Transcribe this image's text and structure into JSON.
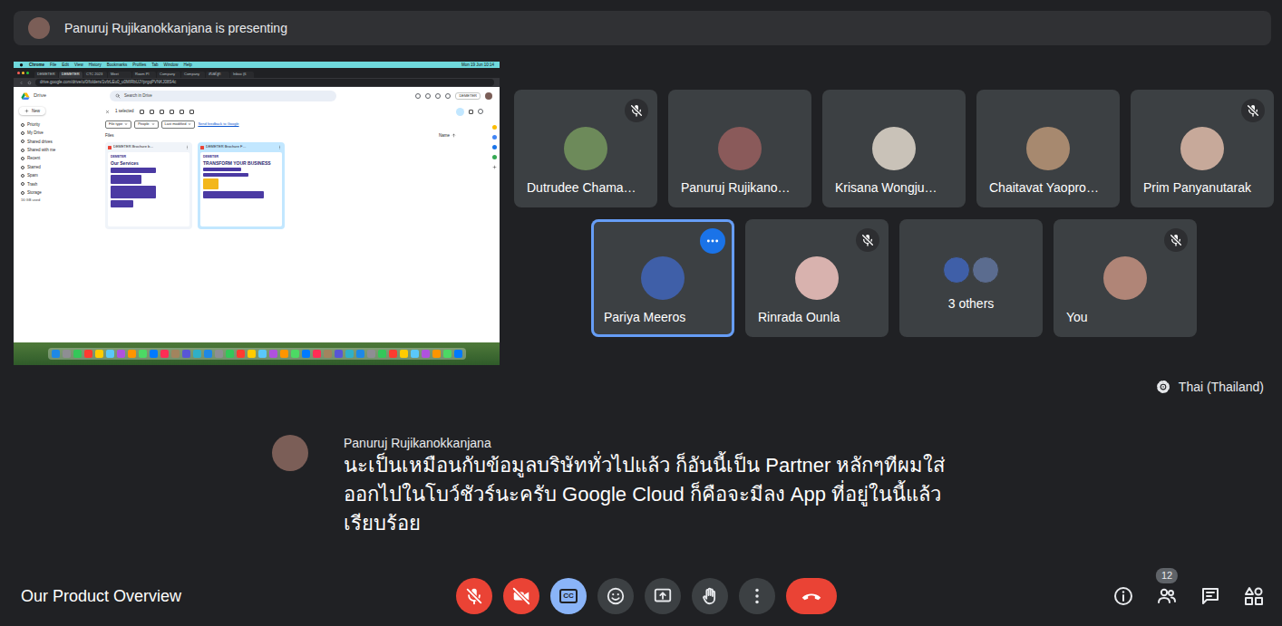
{
  "presenting_banner": {
    "text": "Panuruj Rujikanokkanjana is presenting"
  },
  "shared_screen": {
    "menubar": {
      "items": [
        "Chrome",
        "File",
        "Edit",
        "View",
        "History",
        "Bookmarks",
        "Profiles",
        "Tab",
        "Window",
        "Help"
      ],
      "clock": "Mon 19 Jun 10:14"
    },
    "browser_tabs": [
      {
        "label": "DEMETER",
        "selected": false
      },
      {
        "label": "DEMETER",
        "selected": true
      },
      {
        "label": "CTC 2023",
        "selected": false
      },
      {
        "label": "Meet",
        "selected": false
      },
      {
        "label": "Room Pl",
        "selected": false
      },
      {
        "label": "Company",
        "selected": false
      },
      {
        "label": "Company",
        "selected": false
      },
      {
        "label": "สไลด์ลูก",
        "selected": false
      },
      {
        "label": "Inbox (6",
        "selected": false
      }
    ],
    "address": "drive.google.com/drive/u/0/folders/1vfzLEu0_u0MIRbUJYprgqPVNKJ08S4c",
    "drive": {
      "app_name": "Drive",
      "search_placeholder": "Search in Drive",
      "account_chip": "DEMETER",
      "new_button": "New",
      "nav": [
        {
          "label": "Priority",
          "selected": false
        },
        {
          "label": "My Drive",
          "selected": false
        },
        {
          "label": "Shared drives",
          "selected": false
        },
        {
          "label": "Shared with me",
          "selected": false
        },
        {
          "label": "Recent",
          "selected": false
        },
        {
          "label": "Starred",
          "selected": false
        },
        {
          "label": "Spam",
          "selected": false
        },
        {
          "label": "Trash",
          "selected": false
        },
        {
          "label": "Storage",
          "selected": false
        }
      ],
      "storage_used": "16 GB used",
      "selection_label": "1 selected",
      "filters": [
        "File type",
        "People",
        "Last modified"
      ],
      "feedback": "Send feedback to Google",
      "section": "Files",
      "sort": "Name",
      "files": [
        {
          "name": "DEMETER Brochure b…",
          "selected": false,
          "thumb_brand": "DEMETER",
          "thumb_title": "Our Services"
        },
        {
          "name": "DEMETER Brochure F…",
          "selected": true,
          "thumb_brand": "DEMETER",
          "thumb_title": "TRANSFORM YOUR BUSINESS"
        }
      ]
    }
  },
  "participants": [
    {
      "name": "Dutrudee Chama…",
      "kind": "person",
      "muted": true,
      "selected": false
    },
    {
      "name": "Panuruj Rujikano…",
      "kind": "person",
      "muted": false,
      "selected": false
    },
    {
      "name": "Krisana Wongju…",
      "kind": "person",
      "muted": false,
      "selected": false
    },
    {
      "name": "Chaitavat Yaopro…",
      "kind": "person",
      "muted": false,
      "selected": false
    },
    {
      "name": "Prim Panyanutarak",
      "kind": "person",
      "muted": true,
      "selected": false
    },
    {
      "name": "Pariya Meeros",
      "kind": "person",
      "muted": false,
      "selected": true
    },
    {
      "name": "Rinrada Ounla",
      "kind": "person",
      "muted": true,
      "selected": false
    },
    {
      "name": "3 others",
      "kind": "group",
      "muted": false,
      "selected": false
    },
    {
      "name": "You",
      "kind": "person",
      "muted": true,
      "selected": false
    }
  ],
  "captions": {
    "language": "Thai (Thailand)",
    "speaker": "Panuruj Rujikanokkanjana",
    "lines": [
      "นะเป็นเหมือนกับข้อมูลบริษัททั่วไปแล้ว ก็อันนี้เป็น Partner หลักๆทีผมใส่",
      "ออกไปในโบว์ชัวร์นะครับ Google Cloud ก็คือจะมีลง App ที่อยู่ในนี้แล้ว",
      "เรียบร้อย"
    ]
  },
  "toolbar": {
    "meeting_title": "Our Product Overview",
    "controls": [
      {
        "kind": "mic",
        "on": false
      },
      {
        "kind": "camera",
        "on": false
      },
      {
        "kind": "captions",
        "on": true,
        "label": "CC"
      },
      {
        "kind": "emoji"
      },
      {
        "kind": "present"
      },
      {
        "kind": "hand"
      },
      {
        "kind": "more"
      },
      {
        "kind": "end"
      }
    ],
    "side": [
      {
        "kind": "info"
      },
      {
        "kind": "people",
        "badge": "12"
      },
      {
        "kind": "chat"
      },
      {
        "kind": "activities"
      }
    ]
  }
}
